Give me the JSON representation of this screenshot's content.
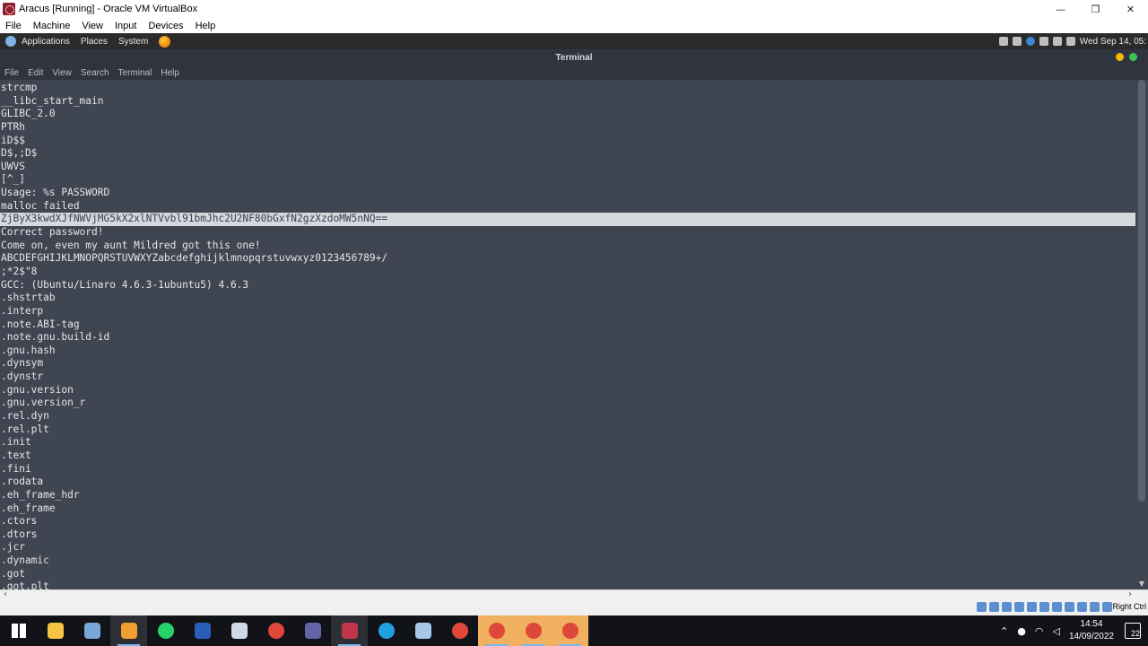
{
  "host_window": {
    "title": "Aracus [Running] - Oracle VM VirtualBox",
    "minimize": "—",
    "restore": "❐",
    "close": "✕",
    "menu": [
      "File",
      "Machine",
      "View",
      "Input",
      "Devices",
      "Help"
    ]
  },
  "guest_panel": {
    "menus": [
      "Applications",
      "Places",
      "System"
    ],
    "clock": "Wed Sep 14, 05:"
  },
  "terminal": {
    "title": "Terminal",
    "menu": [
      "File",
      "Edit",
      "View",
      "Search",
      "Terminal",
      "Help"
    ],
    "highlighted_line_index": 10,
    "lines": [
      "strcmp",
      "__libc_start_main",
      "GLIBC_2.0",
      "PTRh",
      "iD$$",
      "D$,;D$",
      "UWVS",
      "[^_]",
      "Usage: %s PASSWORD",
      "malloc failed",
      "ZjByX3kwdXJfNWVjMG5kX2xlNTVvbl91bmJhc2U2NF80bGxfN2gzXzdoMW5nNQ==",
      "Correct password!",
      "Come on, even my aunt Mildred got this one!",
      "ABCDEFGHIJKLMNOPQRSTUVWXYZabcdefghijklmnopqrstuvwxyz0123456789+/",
      ";*2$\"8",
      "GCC: (Ubuntu/Linaro 4.6.3-1ubuntu5) 4.6.3",
      ".shstrtab",
      ".interp",
      ".note.ABI-tag",
      ".note.gnu.build-id",
      ".gnu.hash",
      ".dynsym",
      ".dynstr",
      ".gnu.version",
      ".gnu.version_r",
      ".rel.dyn",
      ".rel.plt",
      ".init",
      ".text",
      ".fini",
      ".rodata",
      ".eh_frame_hdr",
      ".eh_frame",
      ".ctors",
      ".dtors",
      ".jcr",
      ".dynamic",
      ".got",
      ".got.plt"
    ]
  },
  "vbox_status": {
    "host_key": "Right Ctrl"
  },
  "taskbar": {
    "time": "14:54",
    "date": "14/09/2022",
    "notifications": "22",
    "apps": [
      {
        "name": "start",
        "color": "#ffffff",
        "state": "normal"
      },
      {
        "name": "file-explorer",
        "color": "#f5c542",
        "state": "normal"
      },
      {
        "name": "app-window",
        "color": "#7aa7d9",
        "state": "normal"
      },
      {
        "name": "tool-app",
        "color": "#f0a030",
        "state": "active"
      },
      {
        "name": "whatsapp",
        "color": "#25d366",
        "state": "normal"
      },
      {
        "name": "word",
        "color": "#2b5eb8",
        "state": "normal"
      },
      {
        "name": "package-app",
        "color": "#d0d8e8",
        "state": "normal"
      },
      {
        "name": "chrome",
        "color": "#e0473b",
        "state": "normal"
      },
      {
        "name": "teams",
        "color": "#6264a7",
        "state": "normal"
      },
      {
        "name": "virtualbox",
        "color": "#c0354a",
        "state": "active"
      },
      {
        "name": "edge",
        "color": "#1fa0e0",
        "state": "normal"
      },
      {
        "name": "brush-app",
        "color": "#a8c8e8",
        "state": "normal"
      },
      {
        "name": "chrome",
        "color": "#e0473b",
        "state": "normal"
      },
      {
        "name": "chrome",
        "color": "#e0473b",
        "state": "open"
      },
      {
        "name": "chrome",
        "color": "#e0473b",
        "state": "open"
      },
      {
        "name": "chrome",
        "color": "#e0473b",
        "state": "open"
      }
    ]
  }
}
